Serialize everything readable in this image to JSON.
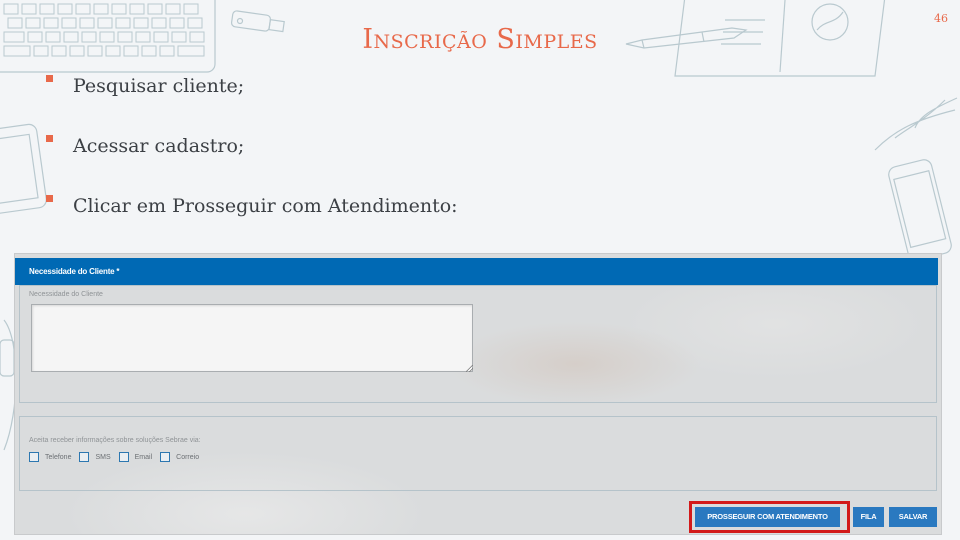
{
  "slide": {
    "title": "Inscrição Simples",
    "page_number": "46",
    "bullets": [
      "Pesquisar cliente;",
      "Acessar cadastro;",
      "Clicar em Prosseguir com Atendimento:"
    ],
    "accent_color": "#e8694a"
  },
  "form": {
    "panel_title": "Necessidade do Cliente *",
    "field_label": "Necessidade do Cliente",
    "field_value": "",
    "options_label": "Aceita receber informações sobre soluções Sebrae via:",
    "options": [
      {
        "label": "Telefone",
        "checked": false
      },
      {
        "label": "SMS",
        "checked": false
      },
      {
        "label": "Email",
        "checked": false
      },
      {
        "label": "Correio",
        "checked": false
      }
    ],
    "header_color": "#0069b4"
  },
  "buttons": {
    "proceed": "PROSSEGUIR COM ATENDIMENTO",
    "queue": "FILA",
    "save": "SALVAR",
    "button_color": "#2a79c0",
    "highlight_color": "#d21a1a"
  }
}
